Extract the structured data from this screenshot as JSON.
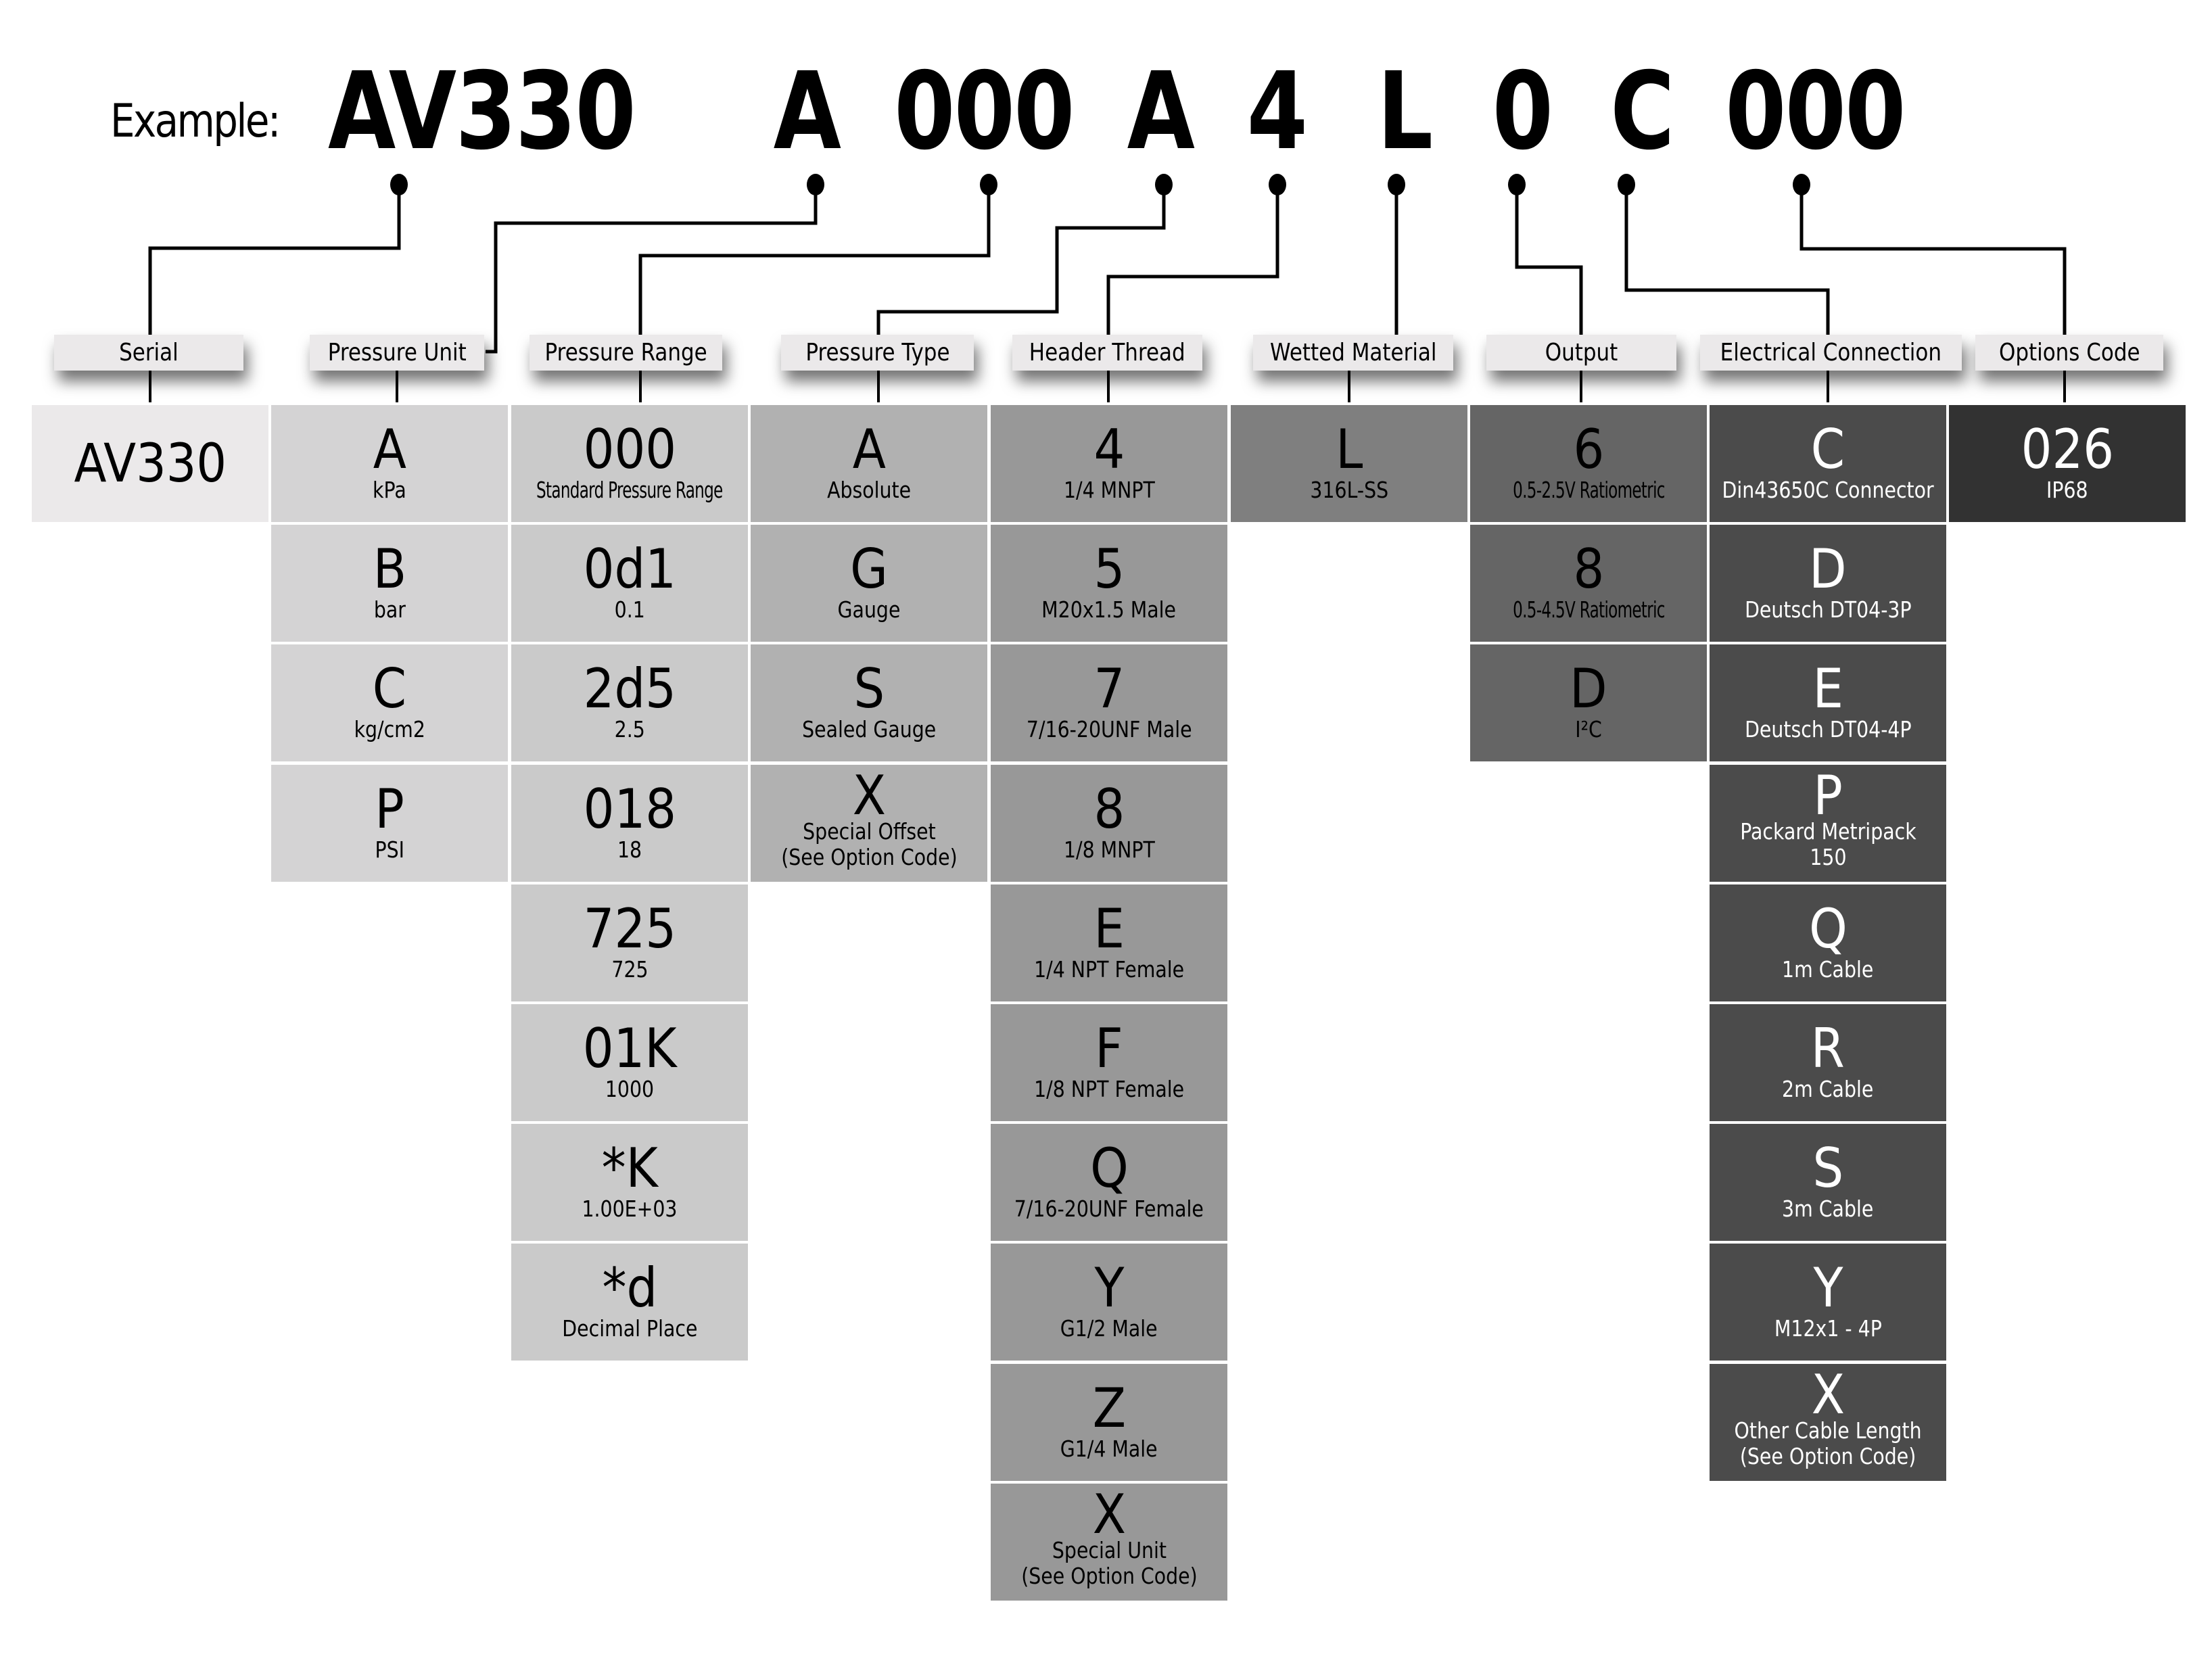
{
  "example": {
    "label": "Example:",
    "parts": [
      "AV330",
      "A",
      "000",
      "A",
      "4",
      "L",
      "0",
      "C",
      "000"
    ]
  },
  "colors": {
    "header_bg": "#ebe9ea",
    "columns": [
      "#ebe9ea",
      "#d4d3d4",
      "#cacaca",
      "#b1b1b1",
      "#989898",
      "#7f7f7f",
      "#656565",
      "#4b4b4b",
      "#323232"
    ]
  },
  "columns": [
    {
      "header": "Serial",
      "options": [
        {
          "code": "AV330",
          "desc": ""
        }
      ]
    },
    {
      "header": "Pressure Unit",
      "options": [
        {
          "code": "A",
          "desc": "kPa"
        },
        {
          "code": "B",
          "desc": "bar"
        },
        {
          "code": "C",
          "desc": "kg/cm2"
        },
        {
          "code": "P",
          "desc": "PSI"
        }
      ]
    },
    {
      "header": "Pressure Range",
      "options": [
        {
          "code": "000",
          "desc": "Standard Pressure Range"
        },
        {
          "code": "0d1",
          "desc": "0.1"
        },
        {
          "code": "2d5",
          "desc": "2.5"
        },
        {
          "code": "018",
          "desc": "18"
        },
        {
          "code": "725",
          "desc": "725"
        },
        {
          "code": "01K",
          "desc": "1000"
        },
        {
          "code": "*K",
          "desc": "1.00E+03"
        },
        {
          "code": "*d",
          "desc": "Decimal Place"
        }
      ]
    },
    {
      "header": "Pressure Type",
      "options": [
        {
          "code": "A",
          "desc": "Absolute"
        },
        {
          "code": "G",
          "desc": "Gauge"
        },
        {
          "code": "S",
          "desc": "Sealed Gauge"
        },
        {
          "code": "X",
          "desc": "Special Offset\n(See Option Code)"
        }
      ]
    },
    {
      "header": "Header Thread",
      "options": [
        {
          "code": "4",
          "desc": "1/4 MNPT"
        },
        {
          "code": "5",
          "desc": "M20x1.5 Male"
        },
        {
          "code": "7",
          "desc": "7/16-20UNF Male"
        },
        {
          "code": "8",
          "desc": "1/8 MNPT"
        },
        {
          "code": "E",
          "desc": "1/4 NPT Female"
        },
        {
          "code": "F",
          "desc": "1/8 NPT Female"
        },
        {
          "code": "Q",
          "desc": "7/16-20UNF Female"
        },
        {
          "code": "Y",
          "desc": "G1/2 Male"
        },
        {
          "code": "Z",
          "desc": "G1/4 Male"
        },
        {
          "code": "X",
          "desc": "Special Unit\n(See Option Code)"
        }
      ]
    },
    {
      "header": "Wetted Material",
      "options": [
        {
          "code": "L",
          "desc": "316L-SS"
        }
      ]
    },
    {
      "header": "Output",
      "options": [
        {
          "code": "6",
          "desc": "0.5-2.5V Ratiometric"
        },
        {
          "code": "8",
          "desc": "0.5-4.5V Ratiometric"
        },
        {
          "code": "D",
          "desc": "I²C"
        }
      ]
    },
    {
      "header": "Electrical Connection",
      "options": [
        {
          "code": "C",
          "desc": "Din43650C Connector"
        },
        {
          "code": "D",
          "desc": "Deutsch DT04-3P"
        },
        {
          "code": "E",
          "desc": "Deutsch DT04-4P"
        },
        {
          "code": "P",
          "desc": "Packard Metripack\n150"
        },
        {
          "code": "Q",
          "desc": "1m Cable"
        },
        {
          "code": "R",
          "desc": "2m Cable"
        },
        {
          "code": "S",
          "desc": "3m Cable"
        },
        {
          "code": "Y",
          "desc": "M12x1 - 4P"
        },
        {
          "code": "X",
          "desc": "Other Cable Length\n(See Option Code)"
        }
      ]
    },
    {
      "header": "Options Code",
      "options": [
        {
          "code": "026",
          "desc": "IP68"
        }
      ]
    }
  ]
}
